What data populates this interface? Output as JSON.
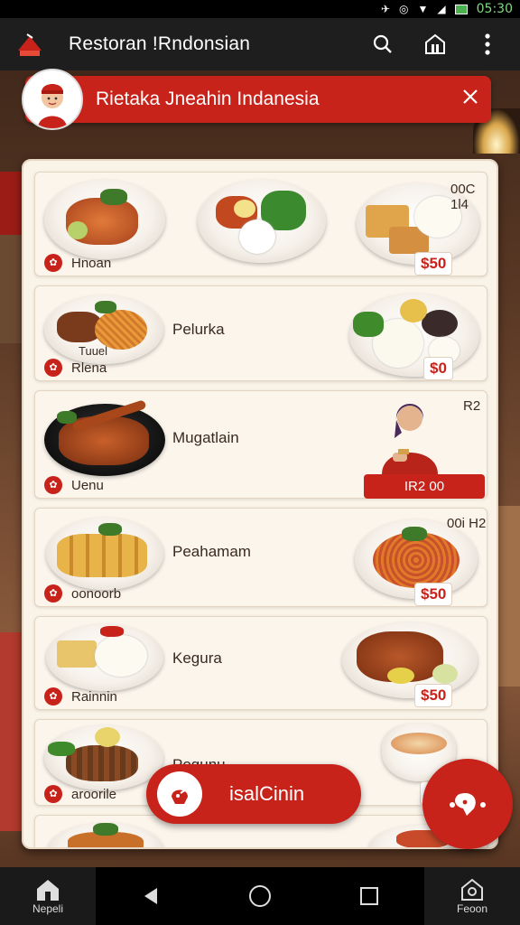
{
  "status_bar": {
    "time": "05:30"
  },
  "app_bar": {
    "title": "Restoran !Rndonsian"
  },
  "banner": {
    "text": "Rietaka Jneahin Indanesia"
  },
  "menu": [
    {
      "name": "",
      "tag": "Hnoan",
      "price": "$50",
      "code": "00C 1l4"
    },
    {
      "name": "Pelurka",
      "tag": "Rlena",
      "sub": "Tuuel",
      "price": "$0"
    },
    {
      "name": "Mugatlain",
      "tag": "Uenu",
      "ribbon": "IR2 00",
      "code": "R2"
    },
    {
      "name": "Peahamam",
      "tag": "oonoorb",
      "price": "$50",
      "code": "00i H2"
    },
    {
      "name": "Kegura",
      "tag": "Rainnin",
      "price": "$50"
    },
    {
      "name": "Pogunu",
      "tag": "aroorile",
      "price": "$"
    }
  ],
  "order_button": {
    "label": "isalCinin"
  },
  "bottom_nav": {
    "home_label": "Nepeli",
    "right_label": "Feoon"
  },
  "colors": {
    "accent": "#c8231a",
    "panel": "#faf3e8",
    "appbar": "#1e1e1e"
  }
}
